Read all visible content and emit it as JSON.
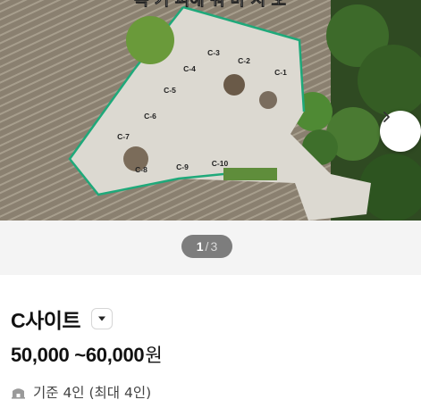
{
  "hero": {
    "banner_text": "쪽 기 피해 쿼 마 시 오",
    "site_labels": [
      "C-1",
      "C-2",
      "C-3",
      "C-4",
      "C-5",
      "C-6",
      "C-7",
      "C-8",
      "C-9",
      "C-10"
    ],
    "next_icon": "chevron-right-icon"
  },
  "pager": {
    "current": "1",
    "separator": "/",
    "total": "3"
  },
  "site": {
    "title": "C사이트",
    "dropdown_icon": "caret-down-icon",
    "price_range": "50,000 ~60,000",
    "price_unit": "원",
    "capacity_icon": "tent-icon",
    "capacity": "기준 4인 (최대 4인)"
  },
  "colors": {
    "pager_bg": "#7d7d7d",
    "pager_strip": "#f4f4f4",
    "fence": "#1fa97a",
    "gravel": "#dcd9d1"
  }
}
